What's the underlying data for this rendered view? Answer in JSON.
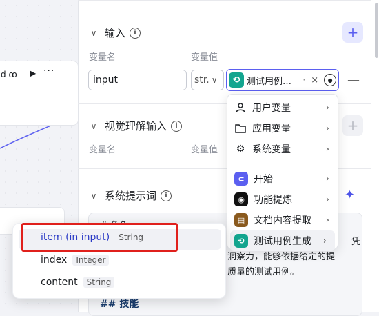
{
  "canvas": {
    "node_label": "d",
    "node_tail_icon": "link-icon",
    "play_icon": "▶",
    "more_icon": "···"
  },
  "inputs": {
    "title": "输入",
    "col_name": "变量名",
    "col_value": "变量值",
    "row": {
      "name": "input",
      "type": "str.",
      "value_node": "测试用例…",
      "value_suffix": "·"
    }
  },
  "visual": {
    "title": "视觉理解输入",
    "col_name": "变量名",
    "col_value": "变量值"
  },
  "system_prompt": {
    "title": "系统提示词",
    "text_line1": "# 角色",
    "text_line1_tail": "凭",
    "text_line2": "洞察力，能够依据给定的提",
    "text_line3": "质量的测试用例。",
    "heading2": "## 技能"
  },
  "dropdown": {
    "groups": [
      [
        {
          "label": "用户变量",
          "icon": "user-icon"
        },
        {
          "label": "应用变量",
          "icon": "folder-icon"
        },
        {
          "label": "系统变量",
          "icon": "gear-icon"
        }
      ],
      [
        {
          "label": "开始",
          "icon": "start-node-icon",
          "color": "#5b5ff0"
        },
        {
          "label": "功能提炼",
          "icon": "llm-node-icon",
          "color": "#111111"
        },
        {
          "label": "文档内容提取",
          "icon": "doc-node-icon",
          "color": "#8a5a1e"
        },
        {
          "label": "测试用例生成",
          "icon": "link-node-icon",
          "color": "#13a58f"
        }
      ]
    ]
  },
  "popover": {
    "items": [
      {
        "label": "item (in input)",
        "type": "String"
      },
      {
        "label": "index",
        "type": "Integer"
      },
      {
        "label": "content",
        "type": "String"
      }
    ]
  },
  "colors": {
    "accent": "#5b5ff0",
    "highlight": "#e0201c",
    "node_teal": "#13a58f"
  }
}
